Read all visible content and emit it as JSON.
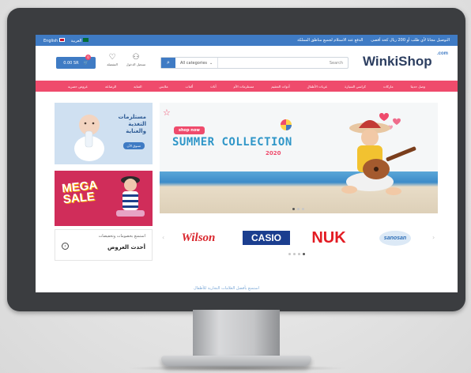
{
  "topbar": {
    "promo_1": "التوصيل مجانا لأي طلب أو 200 ريال كحد أقصى",
    "promo_2": "الدفع عند الاستلام لجميع مناطق المملكة",
    "lang_en": "English",
    "lang_ar": "العربية"
  },
  "header": {
    "cart_label": "0.00 SR",
    "cart_count": "0",
    "wishlist_label": "المفضلة",
    "account_label": "تسجيل الدخول",
    "search_category": "All categories",
    "search_placeholder": "Search",
    "logo": "WinkiShop",
    "logo_suffix": ".com"
  },
  "nav": {
    "items": [
      "عروض حصرية",
      "الرضاعة",
      "العناية",
      "ملابس",
      "ألعاب",
      "أثاث",
      "مستلزمات الأم",
      "أدوات التعقيم",
      "عربات الأطفال",
      "كراسي السيارة",
      "ماركات",
      "وصل حديثا"
    ]
  },
  "promo_tiles": {
    "tile1_line1": "مستلزمات",
    "tile1_line2": "التغذية",
    "tile1_line3": "والعناية",
    "tile1_cta": "تسوق الآن",
    "tile2_line1": "MEGA",
    "tile2_line2": "SALE",
    "tile3_line1": "استمتع بخصومات وتخفيضات",
    "tile3_line2": "أحدث العروض"
  },
  "banner": {
    "cta": "shop now",
    "title": "SUMMER COLLECTION",
    "year": "2020"
  },
  "brands": [
    "Wilson",
    "CASIO",
    "NUK",
    "sanosan"
  ],
  "footer_text": "استمتع بأفضل العلامات التجارية للأطفال",
  "colors": {
    "blue": "#3f7bc4",
    "pink": "#ef4b6c",
    "navy": "#2c3e60"
  }
}
